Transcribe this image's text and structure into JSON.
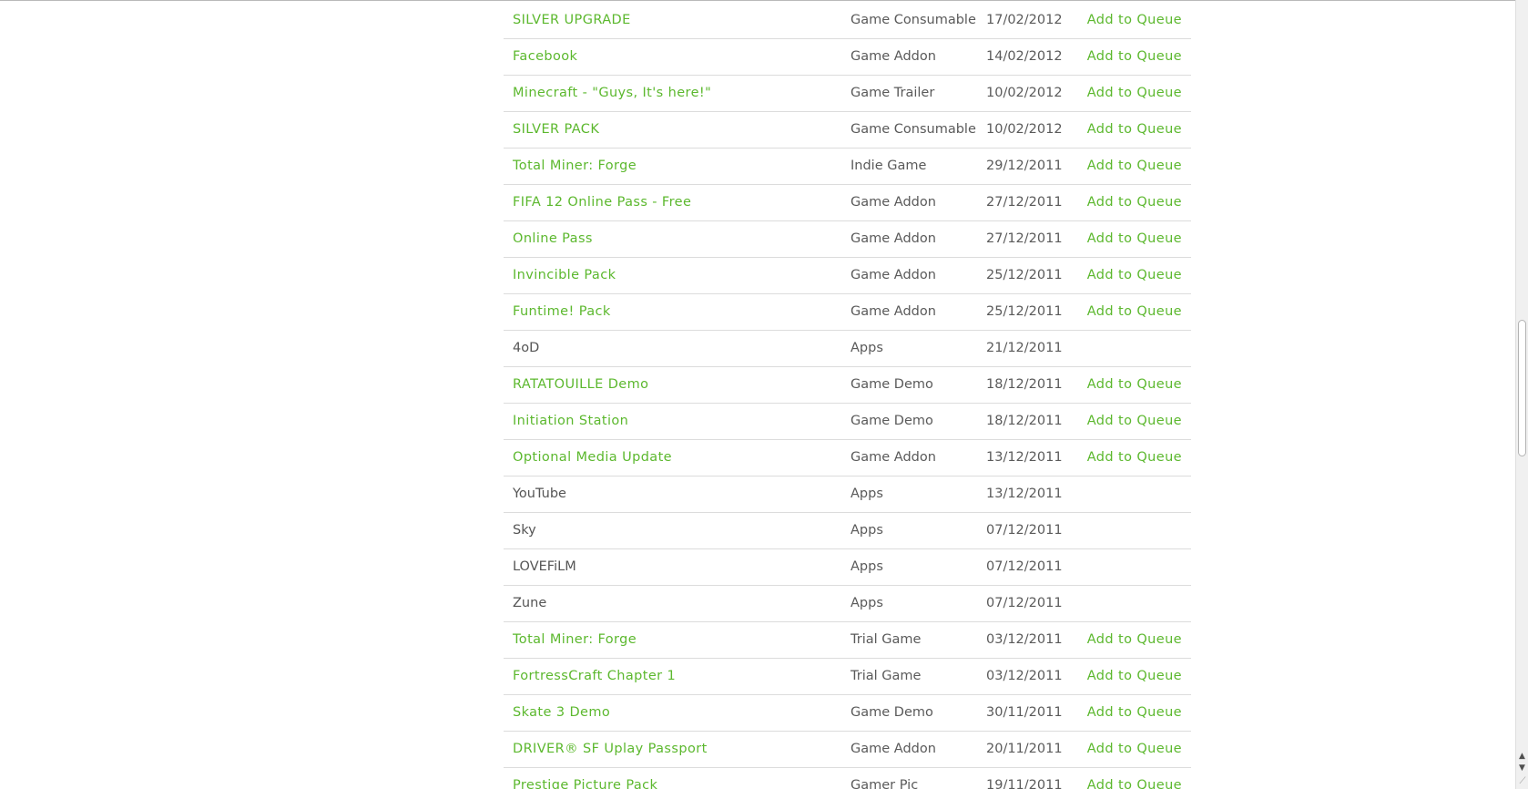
{
  "rows": [
    {
      "title": "SILVER UPGRADE",
      "type": "Game Consumable",
      "date": "17/02/2012",
      "action": "Add to Queue",
      "linked": true
    },
    {
      "title": "Facebook",
      "type": "Game Addon",
      "date": "14/02/2012",
      "action": "Add to Queue",
      "linked": true
    },
    {
      "title": "Minecraft - \"Guys, It's here!\"",
      "type": "Game Trailer",
      "date": "10/02/2012",
      "action": "Add to Queue",
      "linked": true
    },
    {
      "title": "SILVER PACK",
      "type": "Game Consumable",
      "date": "10/02/2012",
      "action": "Add to Queue",
      "linked": true
    },
    {
      "title": "Total Miner: Forge",
      "type": "Indie Game",
      "date": "29/12/2011",
      "action": "Add to Queue",
      "linked": true
    },
    {
      "title": "FIFA 12 Online Pass - Free",
      "type": "Game Addon",
      "date": "27/12/2011",
      "action": "Add to Queue",
      "linked": true
    },
    {
      "title": "Online Pass",
      "type": "Game Addon",
      "date": "27/12/2011",
      "action": "Add to Queue",
      "linked": true
    },
    {
      "title": "Invincible Pack",
      "type": "Game Addon",
      "date": "25/12/2011",
      "action": "Add to Queue",
      "linked": true
    },
    {
      "title": "Funtime! Pack",
      "type": "Game Addon",
      "date": "25/12/2011",
      "action": "Add to Queue",
      "linked": true
    },
    {
      "title": "4oD",
      "type": "Apps",
      "date": "21/12/2011",
      "action": "",
      "linked": false
    },
    {
      "title": "RATATOUILLE Demo",
      "type": "Game Demo",
      "date": "18/12/2011",
      "action": "Add to Queue",
      "linked": true
    },
    {
      "title": "Initiation Station",
      "type": "Game Demo",
      "date": "18/12/2011",
      "action": "Add to Queue",
      "linked": true
    },
    {
      "title": "Optional Media Update",
      "type": "Game Addon",
      "date": "13/12/2011",
      "action": "Add to Queue",
      "linked": true
    },
    {
      "title": "YouTube",
      "type": "Apps",
      "date": "13/12/2011",
      "action": "",
      "linked": false
    },
    {
      "title": "Sky",
      "type": "Apps",
      "date": "07/12/2011",
      "action": "",
      "linked": false
    },
    {
      "title": "LOVEFiLM",
      "type": "Apps",
      "date": "07/12/2011",
      "action": "",
      "linked": false
    },
    {
      "title": "Zune",
      "type": "Apps",
      "date": "07/12/2011",
      "action": "",
      "linked": false
    },
    {
      "title": "Total Miner: Forge",
      "type": "Trial Game",
      "date": "03/12/2011",
      "action": "Add to Queue",
      "linked": true
    },
    {
      "title": "FortressCraft Chapter 1",
      "type": "Trial Game",
      "date": "03/12/2011",
      "action": "Add to Queue",
      "linked": true
    },
    {
      "title": "Skate 3 Demo",
      "type": "Game Demo",
      "date": "30/11/2011",
      "action": "Add to Queue",
      "linked": true
    },
    {
      "title": "DRIVER® SF Uplay Passport",
      "type": "Game Addon",
      "date": "20/11/2011",
      "action": "Add to Queue",
      "linked": true
    },
    {
      "title": "Prestige Picture Pack",
      "type": "Gamer Pic",
      "date": "19/11/2011",
      "action": "Add to Queue",
      "linked": true
    }
  ],
  "scrollbar": {
    "up_icon": "triangle-up-icon",
    "down_icon": "triangle-down-icon",
    "grip_icon": "resize-grip-icon",
    "scroll_position": 0.42
  },
  "colors": {
    "link": "#5cb82e",
    "plain_text": "#555555",
    "divider": "#dcdcdc"
  }
}
